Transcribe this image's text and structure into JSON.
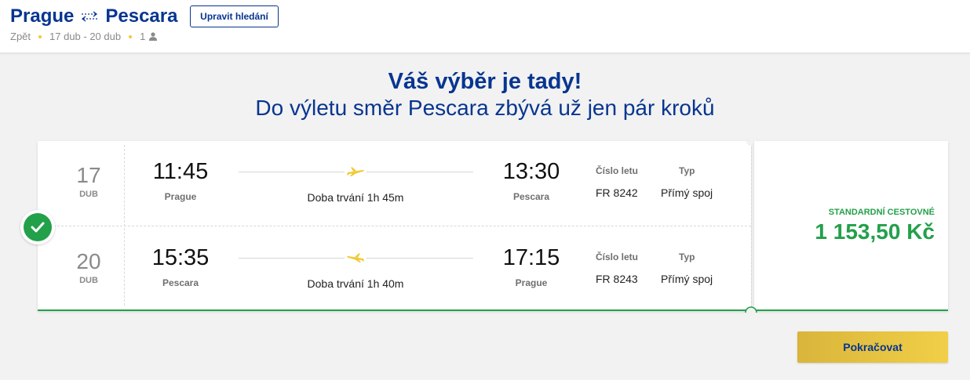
{
  "header": {
    "origin": "Prague",
    "destination": "Pescara",
    "edit_button": "Upravit hledání",
    "trip_type": "Zpět",
    "dates": "17 dub - 20 dub",
    "passengers": "1",
    "route_icon": "return-arrows-icon",
    "passenger_icon": "person-icon"
  },
  "headline": {
    "title": "Váš výběr je tady!",
    "subtitle": "Do výletu směr Pescara zbývá už jen pár kroků"
  },
  "flights": [
    {
      "day": "17",
      "month": "DUB",
      "departure_time": "11:45",
      "departure_city": "Prague",
      "arrival_time": "13:30",
      "arrival_city": "Pescara",
      "duration": "Doba trvání 1h 45m",
      "flight_number_label": "Číslo letu",
      "flight_number": "FR 8242",
      "type_label": "Typ",
      "type": "Přímý spoj"
    },
    {
      "day": "20",
      "month": "DUB",
      "departure_time": "15:35",
      "departure_city": "Pescara",
      "arrival_time": "17:15",
      "arrival_city": "Prague",
      "duration": "Doba trvání 1h 40m",
      "flight_number_label": "Číslo letu",
      "flight_number": "FR 8243",
      "type_label": "Typ",
      "type": "Přímý spoj"
    }
  ],
  "fare": {
    "label": "STANDARDNÍ CESTOVNÉ",
    "price": "1 153,50 Kč"
  },
  "continue_button": "Pokračovat",
  "colors": {
    "brand_blue": "#073590",
    "accent_yellow": "#f1c933",
    "success_green": "#23a04a"
  }
}
